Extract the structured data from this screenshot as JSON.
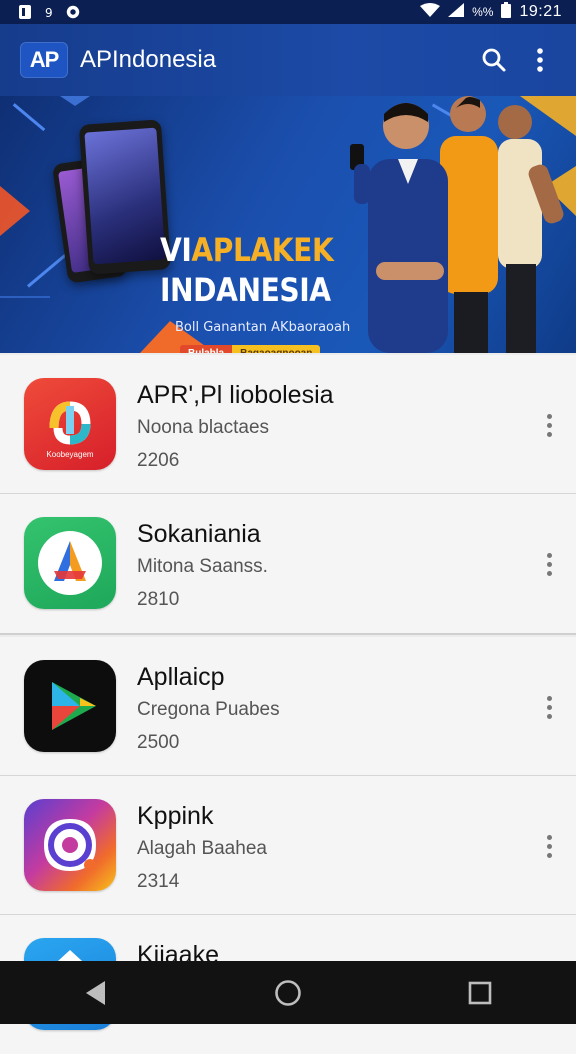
{
  "status_bar": {
    "time": "19:21",
    "battery_pct": "%%",
    "left_icons": [
      "notification-icon-1",
      "notification-icon-2",
      "notification-icon-3"
    ],
    "right_icons": [
      "wifi-icon",
      "signal-icon",
      "battery-icon"
    ]
  },
  "app_bar": {
    "logo_text": "AP",
    "title": "APIndonesia",
    "actions": [
      "search-icon",
      "more-vert-icon"
    ]
  },
  "banner": {
    "title_part1": "VI",
    "title_part2": "APLAKEK",
    "title_line2": "INDANESIA",
    "subtitle": "Boll Ganantan AKbaoraoah",
    "cta_left": "Bulabla",
    "cta_right": "Bagaoagnooan"
  },
  "apps": [
    {
      "name": "APR',Pl liobolesia",
      "developer": "Noona blactaes",
      "number": "2206",
      "icon": "app-icon-colorful-loop",
      "icon_label": "Koobeyagem"
    },
    {
      "name": "Sokaniania",
      "developer": "Mitona Saanss.",
      "number": "2810",
      "icon": "app-icon-green-arrow"
    },
    {
      "name": "Apllaicp",
      "developer": "Cregona Puabes",
      "number": "2500",
      "icon": "app-icon-play-triangle"
    },
    {
      "name": "Kppink",
      "developer": "Alagah Baahea",
      "number": "2314",
      "icon": "app-icon-camera-gradient"
    },
    {
      "name": "Kiiaake",
      "developer": "",
      "number": "",
      "icon": "app-icon-blue-partial"
    }
  ],
  "nav_bar": {
    "buttons": [
      "back-icon",
      "home-icon",
      "recents-icon"
    ]
  },
  "colors": {
    "app_bar": "#1c4aa6",
    "status_bar": "#0b1f52",
    "banner_accent": "#f5b025",
    "list_bg": "#f5f5f5",
    "nav_bar": "#121212"
  }
}
